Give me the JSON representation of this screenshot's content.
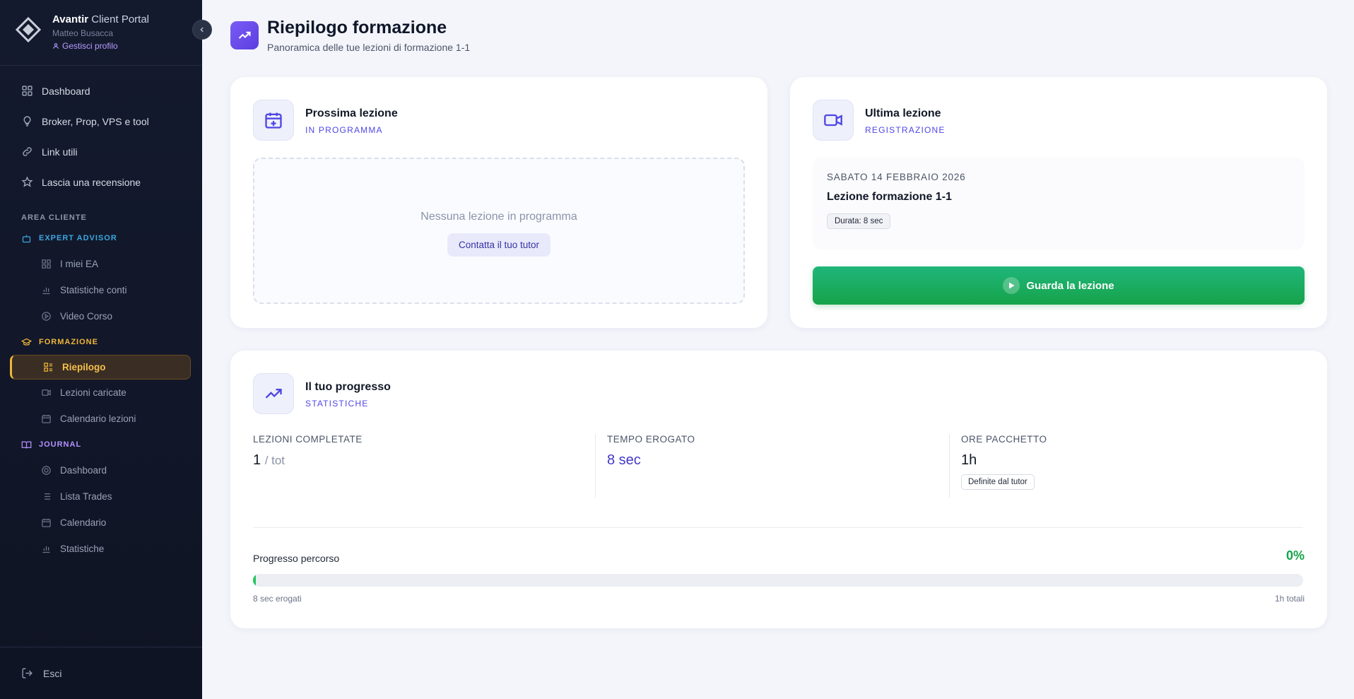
{
  "brand": {
    "name": "Avantir",
    "name_suffix": "Client Portal",
    "user": "Matteo Busacca",
    "profile_link": "Gestisci profilo"
  },
  "nav": {
    "items": [
      {
        "label": "Dashboard",
        "icon": "grid-icon"
      },
      {
        "label": "Broker, Prop, VPS e tool",
        "icon": "lightbulb-icon"
      },
      {
        "label": "Link utili",
        "icon": "link-icon"
      },
      {
        "label": "Lascia una recensione",
        "icon": "star-icon"
      }
    ],
    "section_label": "AREA CLIENTE",
    "expert_advisor": {
      "label": "EXPERT ADVISOR",
      "items": [
        "I miei EA",
        "Statistiche conti",
        "Video Corso"
      ]
    },
    "formazione": {
      "label": "FORMAZIONE",
      "items": [
        "Riepilogo",
        "Lezioni caricate",
        "Calendario lezioni"
      ],
      "active": "Riepilogo"
    },
    "journal": {
      "label": "JOURNAL",
      "items": [
        "Dashboard",
        "Lista Trades",
        "Calendario",
        "Statistiche"
      ]
    },
    "logout": "Esci"
  },
  "page": {
    "title": "Riepilogo formazione",
    "subtitle": "Panoramica delle tue lezioni di formazione 1-1"
  },
  "next_lesson": {
    "title": "Prossima lezione",
    "subtitle": "IN PROGRAMMA",
    "empty_text": "Nessuna lezione in programma",
    "button": "Contatta il tuo tutor"
  },
  "last_lesson": {
    "title": "Ultima lezione",
    "subtitle": "REGISTRAZIONE",
    "date": "SABATO 14 FEBBRAIO 2026",
    "lesson_title": "Lezione formazione 1-1",
    "duration": "Durata: 8 sec",
    "button": "Guarda la lezione"
  },
  "progress": {
    "title": "Il tuo progresso",
    "subtitle": "STATISTICHE",
    "stats": {
      "completed_label": "LEZIONI COMPLETATE",
      "completed_value": "1",
      "completed_suffix": "/ tot",
      "time_label": "TEMPO EROGATO",
      "time_value": "8 sec",
      "package_label": "ORE PACCHETTO",
      "package_value": "1h",
      "package_badge": "Definite dal tutor"
    },
    "bar_label": "Progresso percorso",
    "percent_text": "0%",
    "percent_value": 0,
    "left_caption": "8 sec erogati",
    "right_caption": "1h totali"
  },
  "colors": {
    "accent": "#4f46e5",
    "success": "#16a34a",
    "formazione": "#f0b63a",
    "expert_advisor": "#3aa7e0",
    "journal": "#b491ff"
  }
}
